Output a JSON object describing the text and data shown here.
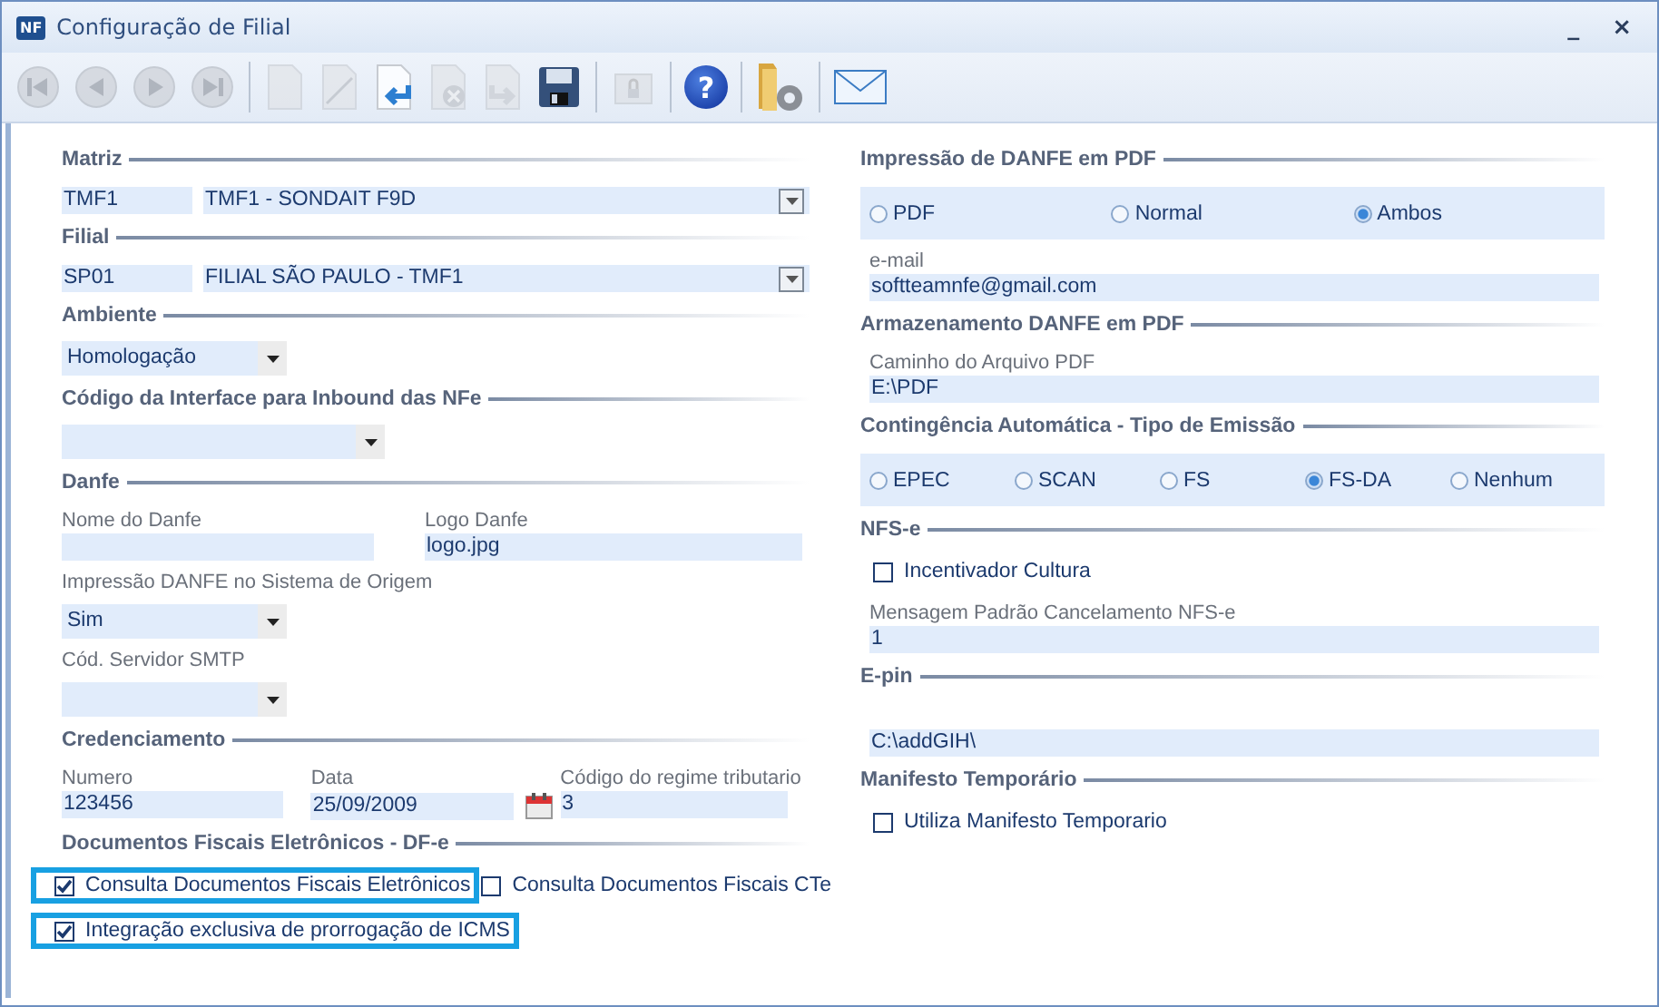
{
  "window": {
    "icon_text": "NF",
    "title": "Configuração de Filial",
    "controls": [
      "_",
      "×"
    ]
  },
  "toolbar": {
    "groups": [
      [
        {
          "kind": "first",
          "disabled": true
        },
        {
          "kind": "prev",
          "disabled": true
        },
        {
          "kind": "next",
          "disabled": true
        },
        {
          "kind": "last",
          "disabled": true
        }
      ],
      [
        {
          "kind": "new",
          "disabled": true
        },
        {
          "kind": "edit",
          "disabled": true
        },
        {
          "kind": "undo",
          "disabled": false
        },
        {
          "kind": "delete",
          "disabled": true
        },
        {
          "kind": "redo",
          "disabled": true
        },
        {
          "kind": "save",
          "disabled": false
        }
      ],
      [
        {
          "kind": "lock",
          "disabled": true
        }
      ],
      [
        {
          "kind": "help",
          "disabled": false,
          "glyph": "?"
        }
      ],
      [
        {
          "kind": "folder-settings",
          "disabled": false
        }
      ],
      [
        {
          "kind": "mail",
          "disabled": false
        }
      ]
    ]
  },
  "left": [
    {
      "title": "Matriz",
      "items": [
        {
          "kind": "code_combo",
          "code": "TMF1",
          "value": "TMF1 - SONDAIT F9D"
        }
      ]
    },
    {
      "title": "Filial",
      "items": [
        {
          "kind": "code_combo",
          "code": "SP01",
          "value": "FILIAL SÃO PAULO - TMF1"
        }
      ]
    },
    {
      "title": "Ambiente",
      "items": [
        {
          "kind": "select",
          "value": "Homologação"
        }
      ]
    },
    {
      "title": "Código da Interface para Inbound das NFe",
      "items": [
        {
          "kind": "select",
          "wide": true
        }
      ]
    },
    {
      "title": "Danfe",
      "items": [
        {
          "kind": "field_row",
          "fields": [
            {
              "label": "Nome do Danfe",
              "kind": "text"
            },
            {
              "label": "Logo Danfe",
              "value": "logo.jpg",
              "kind": "text"
            }
          ]
        },
        {
          "kind": "select",
          "label": "Impressão DANFE no Sistema de Origem",
          "value": "Sim"
        },
        {
          "kind": "select",
          "label": "Cód. Servidor SMTP"
        }
      ]
    },
    {
      "title": "Credenciamento",
      "items": [
        {
          "kind": "field_row",
          "fields": [
            {
              "label": "Numero",
              "value": "123456",
              "kind": "text"
            },
            {
              "label": "Data",
              "value": "25/09/2009",
              "kind": "date"
            },
            {
              "label": "Código do regime tributario",
              "value": "3",
              "kind": "text"
            }
          ]
        }
      ]
    },
    {
      "title": "Documentos Fiscais Eletrônicos - DF-e",
      "items": [
        {
          "kind": "check_row",
          "checks": [
            {
              "label": "Consulta Documentos Fiscais Eletrônicos",
              "checked": true,
              "highlighted": true
            },
            {
              "label": "Consulta Documentos Fiscais CTe",
              "checked": false,
              "highlighted": false
            }
          ]
        },
        {
          "kind": "check_row",
          "checks": [
            {
              "label": "Integração exclusiva de prorrogação de ICMS",
              "checked": true,
              "highlighted": true
            }
          ]
        }
      ]
    }
  ],
  "right": [
    {
      "title": "Impressão de DANFE em PDF",
      "items": [
        {
          "kind": "radios",
          "options": [
            {
              "label": "PDF",
              "selected": false
            },
            {
              "label": "Normal",
              "selected": false
            },
            {
              "label": "Ambos",
              "selected": true
            }
          ]
        },
        {
          "kind": "label_field",
          "label": "e-mail",
          "value": "softteamnfe@gmail.com"
        }
      ]
    },
    {
      "title": "Armazenamento DANFE em PDF",
      "items": [
        {
          "kind": "label_field",
          "label": "Caminho do Arquivo PDF",
          "value": "E:\\PDF"
        }
      ]
    },
    {
      "title": "Contingência Automática - Tipo de Emissão",
      "items": [
        {
          "kind": "radios",
          "options": [
            {
              "label": "EPEC",
              "selected": false
            },
            {
              "label": "SCAN",
              "selected": false
            },
            {
              "label": "FS",
              "selected": false
            },
            {
              "label": "FS-DA",
              "selected": true
            },
            {
              "label": "Nenhum",
              "selected": false
            }
          ]
        }
      ]
    },
    {
      "title": "NFS-e",
      "items": [
        {
          "kind": "check_row",
          "checks": [
            {
              "label": "Incentivador Cultura",
              "checked": false,
              "highlighted": false
            }
          ]
        },
        {
          "kind": "label_field",
          "label": "Mensagem Padrão Cancelamento NFS-e",
          "value": "1"
        }
      ]
    },
    {
      "title": "E-pin",
      "items": [
        {
          "kind": "label_field",
          "value": "C:\\addGIH\\"
        }
      ]
    },
    {
      "title": "Manifesto Temporário",
      "items": [
        {
          "kind": "check_row",
          "checks": [
            {
              "label": "Utiliza Manifesto Temporario",
              "checked": false,
              "highlighted": false
            }
          ]
        }
      ]
    }
  ]
}
